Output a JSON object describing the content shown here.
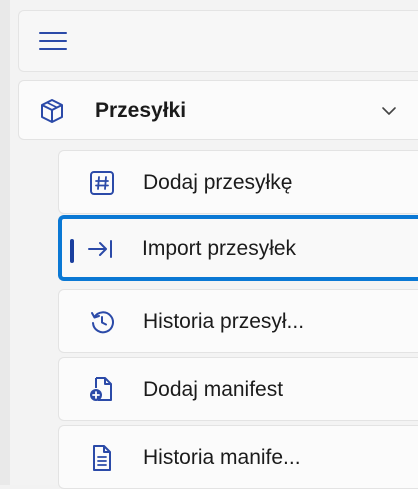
{
  "nav": {
    "menu_icon": "hamburger-menu-icon",
    "group": {
      "label": "Przesyłki",
      "icon": "package-box-icon",
      "expanded": true,
      "chevron": "chevron-down-icon"
    },
    "items": [
      {
        "label": "Dodaj przesyłkę",
        "icon": "hash-icon",
        "selected": false
      },
      {
        "label": "Import przesyłek",
        "icon": "arrow-right-to-bar-icon",
        "selected": true
      },
      {
        "label": "Historia przesył...",
        "icon": "history-clock-icon",
        "selected": false
      },
      {
        "label": "Dodaj manifest",
        "icon": "add-document-icon",
        "selected": false
      },
      {
        "label": "Historia manife...",
        "icon": "document-list-icon",
        "selected": false
      }
    ]
  },
  "colors": {
    "accent": "#0a78d4",
    "icon": "#2b4aa8",
    "indicator": "#1a3f9e",
    "background": "#f3f3f3"
  }
}
